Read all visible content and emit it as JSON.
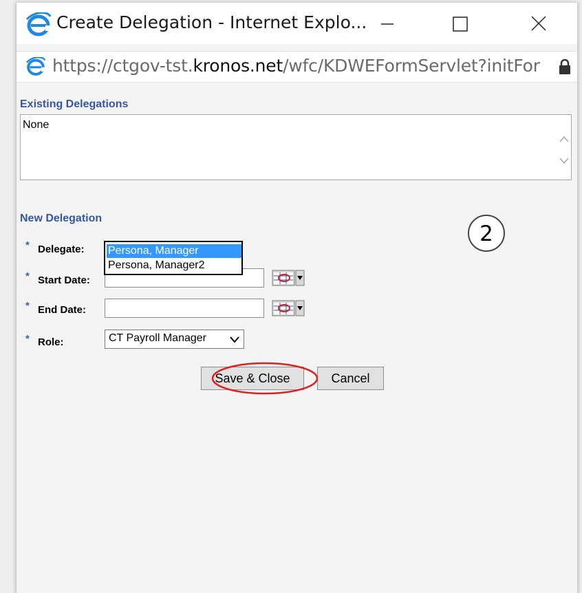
{
  "window": {
    "title": "Create Delegation - Internet Explo...",
    "minimize_glyph": "—",
    "maximize_glyph": "☐",
    "close_glyph": "✕"
  },
  "address": {
    "url_prefix": "https://ctgov-tst.",
    "url_host": "kronos.net",
    "url_suffix": "/wfc/KDWEFormServlet?initFor",
    "lock_icon": "lock-icon"
  },
  "existing": {
    "title": "Existing Delegations",
    "value": "None"
  },
  "new_delegation": {
    "title": "New Delegation",
    "required_marker": "*",
    "delegate_label": "Delegate:",
    "delegate_options": [
      "Persona, Manager",
      "Persona, Manager2"
    ],
    "delegate_selected": "Persona, Manager",
    "start_date_label": "Start Date:",
    "start_date_value": "",
    "end_date_label": "End Date:",
    "end_date_value": "",
    "role_label": "Role:",
    "role_value": "CT Payroll Manager"
  },
  "buttons": {
    "save_label": "Save & Close",
    "cancel_label": "Cancel"
  },
  "annotation": {
    "step_number": "2",
    "highlight_color": "#e0201f"
  },
  "colors": {
    "section_title": "#3656a4",
    "selection": "#3399ff"
  }
}
